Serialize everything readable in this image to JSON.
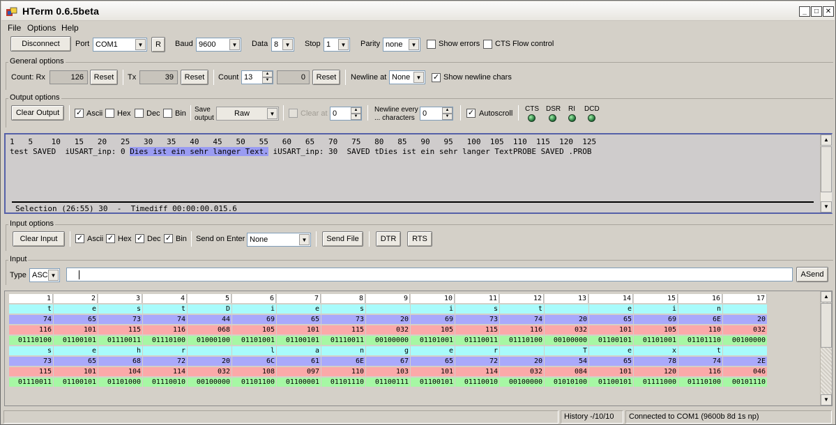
{
  "window": {
    "title": "HTerm 0.6.5beta"
  },
  "menu": [
    "File",
    "Options",
    "Help"
  ],
  "conn": {
    "disconnect": "Disconnect",
    "port_label": "Port",
    "port": "COM1",
    "r": "R",
    "baud_label": "Baud",
    "baud": "9600",
    "data_label": "Data",
    "data": "8",
    "stop_label": "Stop",
    "stop": "1",
    "parity_label": "Parity",
    "parity": "none",
    "show_errors": "Show errors",
    "cts_flow": "CTS Flow control"
  },
  "general": {
    "title": "General options",
    "rx_label": "Count: Rx",
    "rx": "126",
    "reset": "Reset",
    "tx_label": "Tx",
    "tx": "39",
    "count_label": "Count",
    "count": "13",
    "count_val": "0",
    "newline_at": "Newline at",
    "newline_val": "None",
    "show_newline": "Show newline chars"
  },
  "output_opts": {
    "title": "Output options",
    "clear": "Clear Output",
    "ascii": "Ascii",
    "hex": "Hex",
    "dec": "Dec",
    "bin": "Bin",
    "save_1": "Save",
    "save_2": "output",
    "save_mode": "Raw",
    "clear_at": "Clear at",
    "clear_at_val": "0",
    "nl_every_1": "Newline every",
    "nl_every_2": "... characters",
    "nl_every_val": "0",
    "autoscroll": "Autoscroll",
    "leds": [
      "CTS",
      "DSR",
      "RI",
      "DCD"
    ]
  },
  "output": {
    "ruler": "1   5    10   15   20   25   30   35   40   45   50   55   60   65   70   75   80   85   90   95   100  105  110  115  120  125",
    "line_pre": "test SAVED  iUSART_inp: 0 ",
    "line_sel": "Dies ist ein sehr langer Text.",
    "line_post": " iUSART_inp: 30  SAVED tDies ist ein sehr langer TextPROBE SAVED .PROB",
    "status": "Selection (26:55) 30  -  Timediff 00:00:00.015.6"
  },
  "input_opts": {
    "title": "Input options",
    "clear": "Clear Input",
    "ascii": "Ascii",
    "hex": "Hex",
    "dec": "Dec",
    "bin": "Bin",
    "send_on_enter": "Send on Enter",
    "send_on_enter_val": "None",
    "send_file": "Send File",
    "dtr": "DTR",
    "rts": "RTS"
  },
  "input": {
    "title": "Input",
    "type_label": "Type",
    "type_val": "ASC",
    "asend": "ASend"
  },
  "grid": {
    "block1": {
      "head": [
        "1",
        "2",
        "3",
        "4",
        "5",
        "6",
        "7",
        "8",
        "9",
        "10",
        "11",
        "12",
        "13",
        "14",
        "15",
        "16",
        "17"
      ],
      "ascii": [
        "t",
        "e",
        "s",
        "t",
        "D",
        "i",
        "e",
        "s",
        "",
        "i",
        "s",
        "t",
        "",
        "e",
        "i",
        "n",
        ""
      ],
      "hex": [
        "74",
        "65",
        "73",
        "74",
        "44",
        "69",
        "65",
        "73",
        "20",
        "69",
        "73",
        "74",
        "20",
        "65",
        "69",
        "6E",
        "20"
      ],
      "dec": [
        "116",
        "101",
        "115",
        "116",
        "068",
        "105",
        "101",
        "115",
        "032",
        "105",
        "115",
        "116",
        "032",
        "101",
        "105",
        "110",
        "032"
      ],
      "bin": [
        "01110100",
        "01100101",
        "01110011",
        "01110100",
        "01000100",
        "01101001",
        "01100101",
        "01110011",
        "00100000",
        "01101001",
        "01110011",
        "01110100",
        "00100000",
        "01100101",
        "01101001",
        "01101110",
        "00100000"
      ]
    },
    "block2": {
      "ascii": [
        "s",
        "e",
        "h",
        "r",
        "",
        "l",
        "a",
        "n",
        "g",
        "e",
        "r",
        "",
        "T",
        "e",
        "x",
        "t",
        ""
      ],
      "hex": [
        "73",
        "65",
        "68",
        "72",
        "20",
        "6C",
        "61",
        "6E",
        "67",
        "65",
        "72",
        "20",
        "54",
        "65",
        "78",
        "74",
        "2E"
      ],
      "dec": [
        "115",
        "101",
        "104",
        "114",
        "032",
        "108",
        "097",
        "110",
        "103",
        "101",
        "114",
        "032",
        "084",
        "101",
        "120",
        "116",
        "046"
      ],
      "bin": [
        "01110011",
        "01100101",
        "01101000",
        "01110010",
        "00100000",
        "01101100",
        "01100001",
        "01101110",
        "01100111",
        "01100101",
        "01110010",
        "00100000",
        "01010100",
        "01100101",
        "01111000",
        "01110100",
        "00101110"
      ]
    }
  },
  "status": {
    "history": "History  -/10/10",
    "connection": "Connected to COM1   (9600b 8d 1s np)"
  }
}
